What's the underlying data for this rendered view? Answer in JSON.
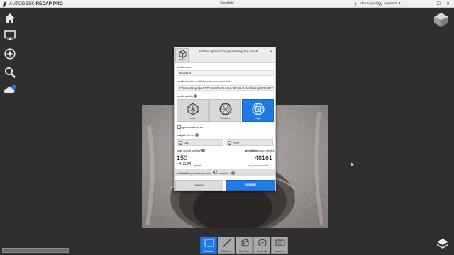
{
  "titlebar": {
    "brand": "AUTODESK",
    "product": "RECAP PRO",
    "window_title": "Bielefeld",
    "user": "john.sayre@a...",
    "connect": "connect",
    "controls": [
      "–",
      "☐",
      "✕"
    ]
  },
  "sidebar": {
    "icons": [
      "home-icon",
      "monitor-icon",
      "compass-icon",
      "search-icon",
      "cloud-icon"
    ]
  },
  "dialog": {
    "header_icon_label": "mesh",
    "header_text": "set the options for generating the mesh",
    "mesh_name_label_bold": "mesh",
    "mesh_name_label_rest": " name",
    "mesh_name_value": "Bielefeld",
    "location_label_bold": "mesh",
    "location_label_rest": " location on Autodesk connected drive",
    "location_value": "C:\\Users\\sayrej\\ACCDocs\\Infrastructure Technical Marketing\\20210517 - Bi...",
    "quality_label_bold": "mesh",
    "quality_label_rest": " quality",
    "quality_options": [
      "Low",
      "Medium",
      "High"
    ],
    "quality_selected": "High",
    "generate_texture": "generate texture",
    "output_label_bold": "output",
    "output_label_rest": " format",
    "formats": [
      "OBJ",
      "RCM"
    ],
    "cost_label_bold": "cost",
    "cost_label_rest": " (cloud credits)",
    "available_label_bold": "available",
    "available_label_rest": " cloud credits",
    "cost_value": "150",
    "available_value": "48161",
    "points_value": "~4.32M",
    "points_unit": "points",
    "buy_credits": "buy more credits",
    "est_label_bold": "estimated",
    "est_label_rest": " processing time:",
    "est_value": "42",
    "est_unit": "minutes",
    "cancel": "cancel",
    "submit": "submit"
  },
  "toolbar": {
    "tools": [
      "Window",
      "Distance",
      "Limit Box",
      "Unclip All",
      "RealView"
    ],
    "active": "Window"
  },
  "colors": {
    "accent": "#1f7ae6",
    "background": "#2f2f2f"
  }
}
